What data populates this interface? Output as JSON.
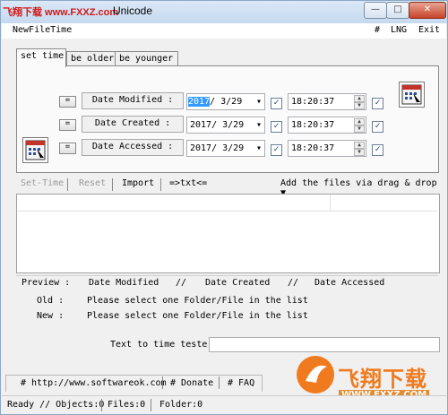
{
  "window": {
    "watermark": "飞翔下载 www.FXXZ.com",
    "title": "Unicode",
    "buttons": [
      "—",
      "□",
      "✕"
    ]
  },
  "menu": {
    "app": "NewFileTime",
    "hash": "#",
    "lng": "LNG",
    "exit": "Exit"
  },
  "tabs": [
    "set time",
    "be older",
    "be younger"
  ],
  "rows": [
    {
      "button": "=",
      "label": "Date Modified :",
      "date": "2017/ 3/29",
      "time": "18:20:37",
      "checked_date": true,
      "checked_time": true
    },
    {
      "button": "=",
      "label": "Date Created :",
      "date": "2017/ 3/29",
      "time": "18:20:37",
      "checked_date": true,
      "checked_time": true
    },
    {
      "button": "=",
      "label": "Date Accessed :",
      "date": "2017/ 3/29",
      "time": "18:20:37",
      "checked_date": true,
      "checked_time": true
    }
  ],
  "date_year_selected": "2017",
  "toolbar": {
    "set_time": "Set-Time",
    "reset": "Reset",
    "import": "Import",
    "txt": "=>txt<=",
    "add_files": "Add the files via drag & drop ▼"
  },
  "preview": {
    "header": [
      "Preview :",
      "Date Modified",
      "//",
      "Date Created",
      "//",
      "Date Accessed"
    ],
    "old_label": "Old :",
    "old_text": "Please select one Folder/File in the list",
    "new_label": "New :",
    "new_text": "Please select one Folder/File in the list"
  },
  "tester": {
    "label": "Text to time tester",
    "value": ""
  },
  "links": [
    "# http://www.softwareok.com",
    "# Donate",
    "# FAQ"
  ],
  "status": {
    "ready": "Ready // Objects:0",
    "files": "Files:0",
    "folder": "Folder:0"
  },
  "corner_watermark": "飞翔下载",
  "corner_watermark_url": "WWW.FXXZ.COM"
}
